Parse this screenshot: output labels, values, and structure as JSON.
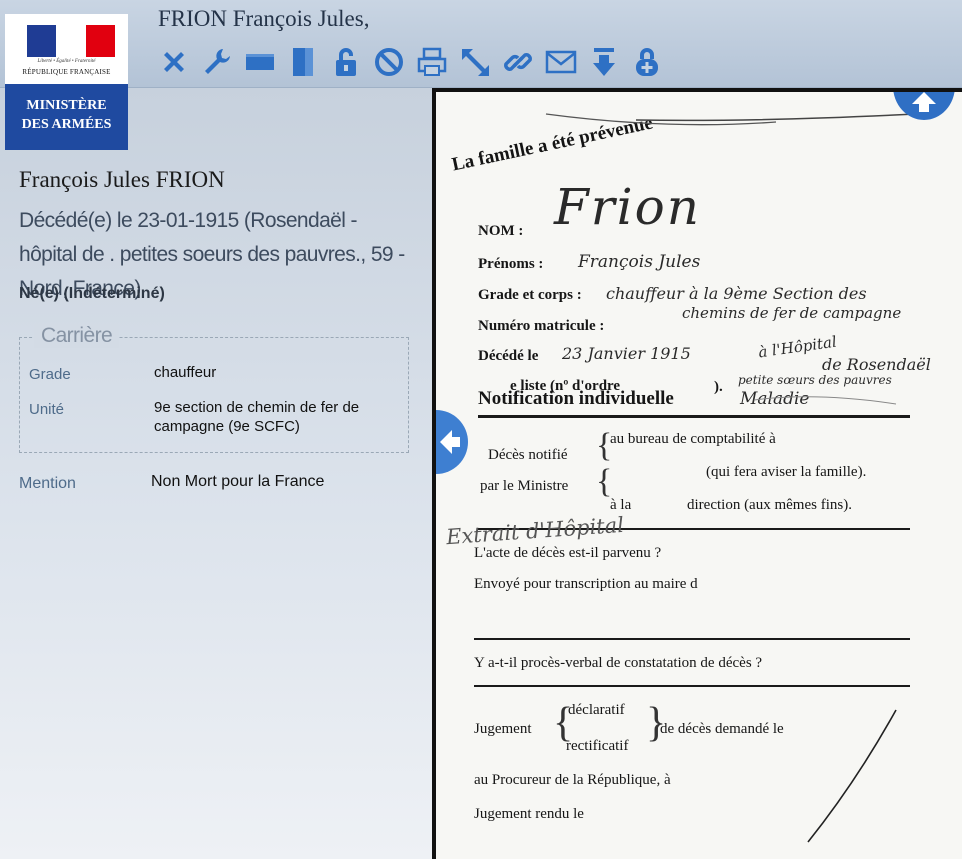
{
  "header": {
    "title": "FRION François Jules,",
    "tools": [
      {
        "icon": "close-icon"
      },
      {
        "icon": "wrench-icon"
      },
      {
        "icon": "horizontal-layout-icon"
      },
      {
        "icon": "vertical-layout-icon"
      },
      {
        "icon": "unlock-icon"
      },
      {
        "icon": "block-icon"
      },
      {
        "icon": "print-icon"
      },
      {
        "icon": "expand-icon"
      },
      {
        "icon": "link-icon"
      },
      {
        "icon": "mail-icon"
      },
      {
        "icon": "download-icon"
      },
      {
        "icon": "add-lock-icon"
      }
    ]
  },
  "logo": {
    "motto": "Liberté • Égalité • Fraternité",
    "republic": "RÉPUBLIQUE FRANÇAISE",
    "ministry_line1": "MINISTÈRE",
    "ministry_line2": "DES ARMÉES"
  },
  "person": {
    "name": "François Jules FRION",
    "death": "Décédé(e) le 23-01-1915 (Rosendaël - hôpital de . petites soeurs des pauvres., 59 - Nord, France)",
    "birth": "Né(e) (Indéterminé)"
  },
  "career": {
    "legend": "Carrière",
    "grade_label": "Grade",
    "grade_value": "chauffeur",
    "unit_label": "Unité",
    "unit_value": "9e section de chemin de fer de campagne (9e SCFC)"
  },
  "mention": {
    "label": "Mention",
    "value": "Non Mort pour la France"
  },
  "document": {
    "stamp": "La famille a été prévenue",
    "nom_label": "NOM :",
    "nom_value": "Frion",
    "prenoms_label": "Prénoms :",
    "prenoms_value": "François Jules",
    "grade_label": "Grade et corps :",
    "grade_value": "chauffeur à la 9ème Section des",
    "grade_value2": "chemins de fer de campagne",
    "matricule_label": "Numéro matricule :",
    "decede_label": "Décédé le",
    "decede_value": "23 Janvier 1915",
    "decede_place1": "à l'Hôpital",
    "decede_place2": "de Rosendaël",
    "decede_place3": "petite sœurs des pauvres",
    "liste_label": "e liste (nº d'ordre",
    "liste_close": ").",
    "maladie": "Maladie",
    "notification": "Notification individuelle",
    "deces_notifie": "Décès notifié",
    "par_ministre": "par le Ministre",
    "bureau": "au bureau de comptabilité à",
    "fera_aviser": "(qui fera aviser la famille).",
    "a_la": "à la",
    "direction": "direction (aux mêmes fins).",
    "extrait": "Extrait d'Hôpital",
    "acte": "L'acte de décès est-il parvenu ?",
    "envoye": "Envoyé pour transcription au maire d",
    "proces": "Y a-t-il procès-verbal de constatation de décès ?",
    "jugement": "Jugement",
    "declaratif": "déclaratif",
    "rectificatif": "rectificatif",
    "demande": "de décès demandé le",
    "procureur": "au Procureur de la République, à",
    "rendu": "Jugement rendu le"
  }
}
